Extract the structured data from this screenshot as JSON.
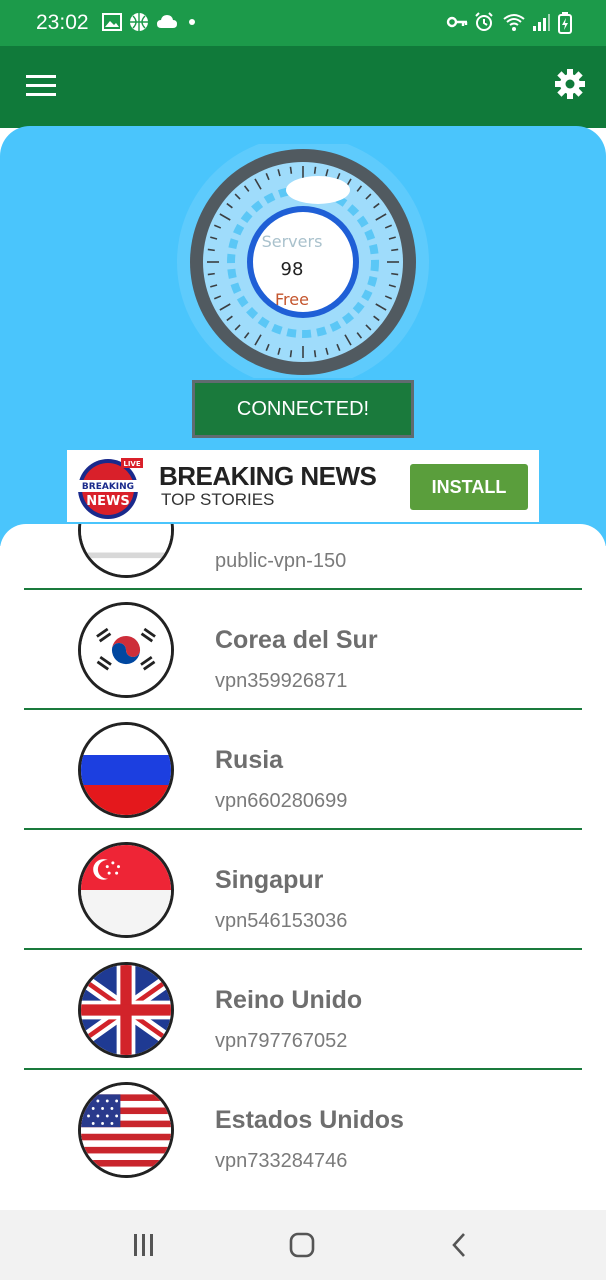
{
  "status_bar": {
    "time": "23:02",
    "left_icons": [
      "image-icon",
      "basketball-icon",
      "cloud-icon",
      "dot-icon"
    ],
    "right_icons": [
      "vpn-key-icon",
      "alarm-icon",
      "wifi-icon",
      "signal-icon",
      "battery-charging-icon"
    ]
  },
  "app_bar": {
    "menu_icon": "hamburger-menu-icon",
    "settings_icon": "gear-icon"
  },
  "gauge": {
    "title": "Servers",
    "count": "98",
    "status": "Free"
  },
  "connect_button": {
    "label": "CONNECTED!"
  },
  "ad": {
    "logo_top": "LIVE",
    "logo_line1": "BREAKING",
    "logo_line2": "NEWS",
    "title": "BREAKING NEWS",
    "subtitle": "TOP STORIES",
    "install_label": "INSTALL"
  },
  "servers": [
    {
      "country": "",
      "host": "public-vpn-150",
      "flag": "partial-flag"
    },
    {
      "country": "Corea del Sur",
      "host": "vpn359926871",
      "flag": "south-korea-flag"
    },
    {
      "country": "Rusia",
      "host": "vpn660280699",
      "flag": "russia-flag"
    },
    {
      "country": "Singapur",
      "host": "vpn546153036",
      "flag": "singapore-flag"
    },
    {
      "country": "Reino Unido",
      "host": "vpn797767052",
      "flag": "united-kingdom-flag"
    },
    {
      "country": "Estados Unidos",
      "host": "vpn733284746",
      "flag": "united-states-flag"
    }
  ],
  "colors": {
    "status_bar": "#1c9a4a",
    "app_bar": "#107a3a",
    "hero_background": "#4ac5fc",
    "connect_button": "#1a7a3c",
    "divider": "#1a7a3c",
    "install_button": "#5a9e3c"
  },
  "nav_bar": {
    "icons": [
      "recent-apps-icon",
      "home-icon",
      "back-icon"
    ]
  }
}
